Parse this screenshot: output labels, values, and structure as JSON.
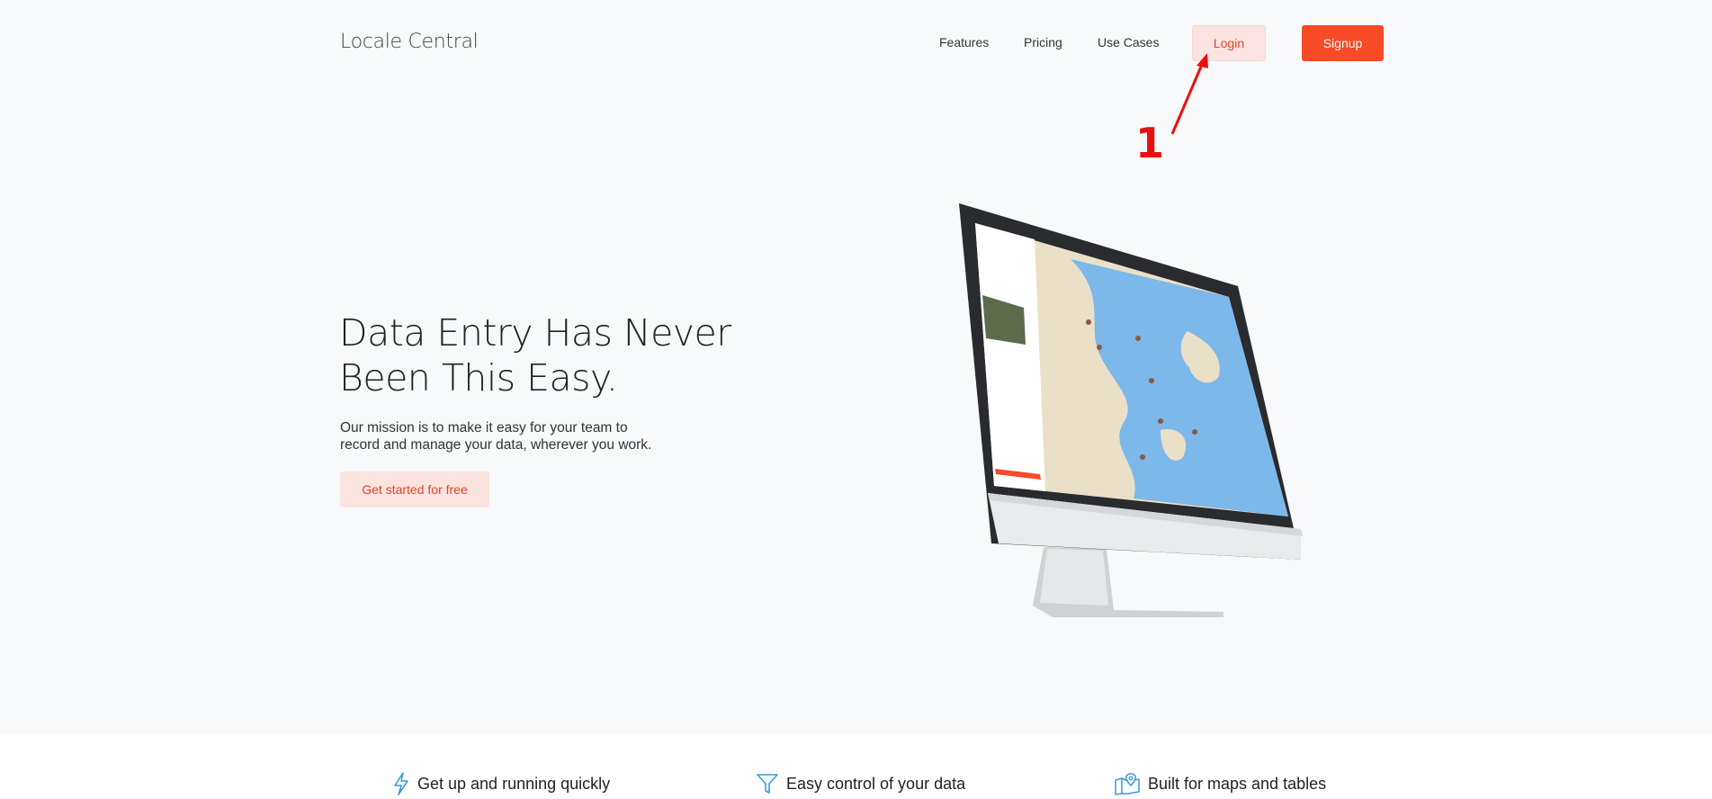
{
  "header": {
    "brand": "Locale Central",
    "nav": {
      "features": "Features",
      "pricing": "Pricing",
      "use_cases": "Use Cases"
    },
    "login_label": "Login",
    "signup_label": "Signup"
  },
  "annotation": {
    "number": "1"
  },
  "hero": {
    "title_line1": "Data Entry Has Never",
    "title_line2": "Been This Easy.",
    "subtitle_line1": "Our mission is to make it easy for your team to",
    "subtitle_line2": "record and manage your data, wherever you work.",
    "cta_label": "Get started for free"
  },
  "features": [
    {
      "icon": "lightning-icon",
      "label": "Get up and running quickly"
    },
    {
      "icon": "filter-icon",
      "label": "Easy control of your data"
    },
    {
      "icon": "map-pin-icon",
      "label": "Built for maps and tables"
    }
  ],
  "colors": {
    "accent": "#f64b26",
    "accent_soft": "#fbe4e1",
    "annotation_red": "#ea0f0f",
    "feature_icon_blue": "#3b9ad9"
  }
}
